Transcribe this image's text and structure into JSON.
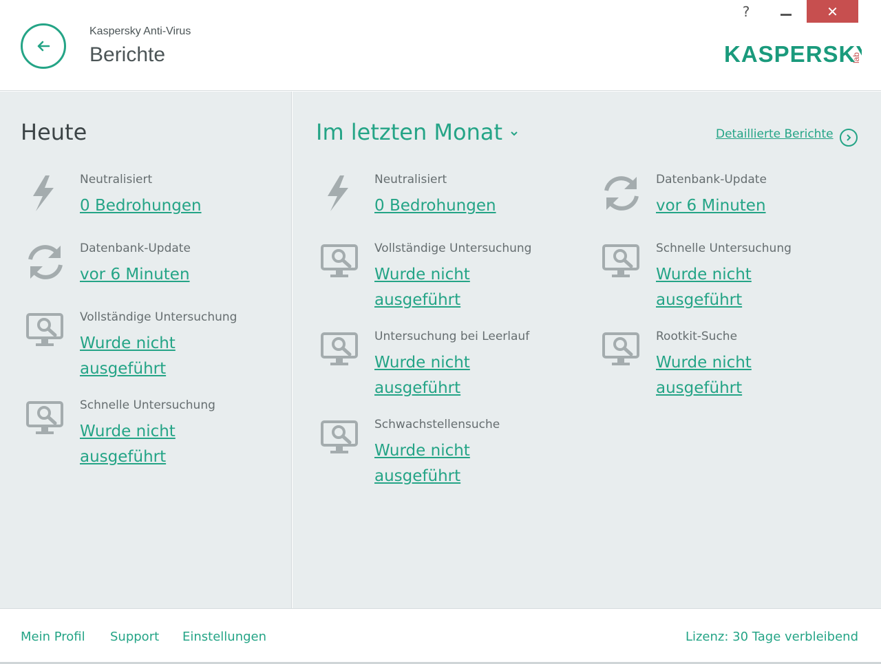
{
  "header": {
    "app_name": "Kaspersky Anti-Virus",
    "title": "Berichte",
    "logo_text": "KASPERSKY",
    "logo_sub": "lab",
    "help_label": "?",
    "close_label": "✕"
  },
  "today": {
    "title": "Heute",
    "items": [
      {
        "icon": "lightning-icon",
        "label": "Neutralisiert",
        "value": "0 Bedrohungen"
      },
      {
        "icon": "refresh-icon",
        "label": "Datenbank-Update",
        "value": "vor 6 Minuten"
      },
      {
        "icon": "monitor-scan-icon",
        "label": "Vollständige Untersuchung",
        "value": "Wurde nicht ausgeführt"
      },
      {
        "icon": "monitor-scan-icon",
        "label": "Schnelle Untersuchung",
        "value": "Wurde nicht ausgeführt"
      }
    ]
  },
  "month": {
    "title": "Im letzten Monat",
    "detail_link": "Detaillierte Berichte",
    "col1": [
      {
        "icon": "lightning-icon",
        "label": "Neutralisiert",
        "value": "0 Bedrohungen"
      },
      {
        "icon": "monitor-scan-icon",
        "label": "Vollständige Untersuchung",
        "value": "Wurde nicht ausgeführt"
      },
      {
        "icon": "monitor-scan-icon",
        "label": "Untersuchung bei Leerlauf",
        "value": "Wurde nicht ausgeführt"
      },
      {
        "icon": "monitor-scan-icon",
        "label": "Schwachstellensuche",
        "value": "Wurde nicht ausgeführt"
      }
    ],
    "col2": [
      {
        "icon": "refresh-icon",
        "label": "Datenbank-Update",
        "value": "vor 6 Minuten"
      },
      {
        "icon": "monitor-scan-icon",
        "label": "Schnelle Untersuchung",
        "value": "Wurde nicht ausgeführt"
      },
      {
        "icon": "monitor-scan-icon",
        "label": "Rootkit-Suche",
        "value": "Wurde nicht ausgeführt"
      }
    ]
  },
  "footer": {
    "links": [
      "Mein Profil",
      "Support",
      "Einstellungen"
    ],
    "license": "Lizenz: 30 Tage verbleibend"
  },
  "colors": {
    "accent": "#24a486",
    "panel_bg": "#e8edee",
    "close_red": "#c74f4f",
    "icon_gray": "#a4acae"
  }
}
